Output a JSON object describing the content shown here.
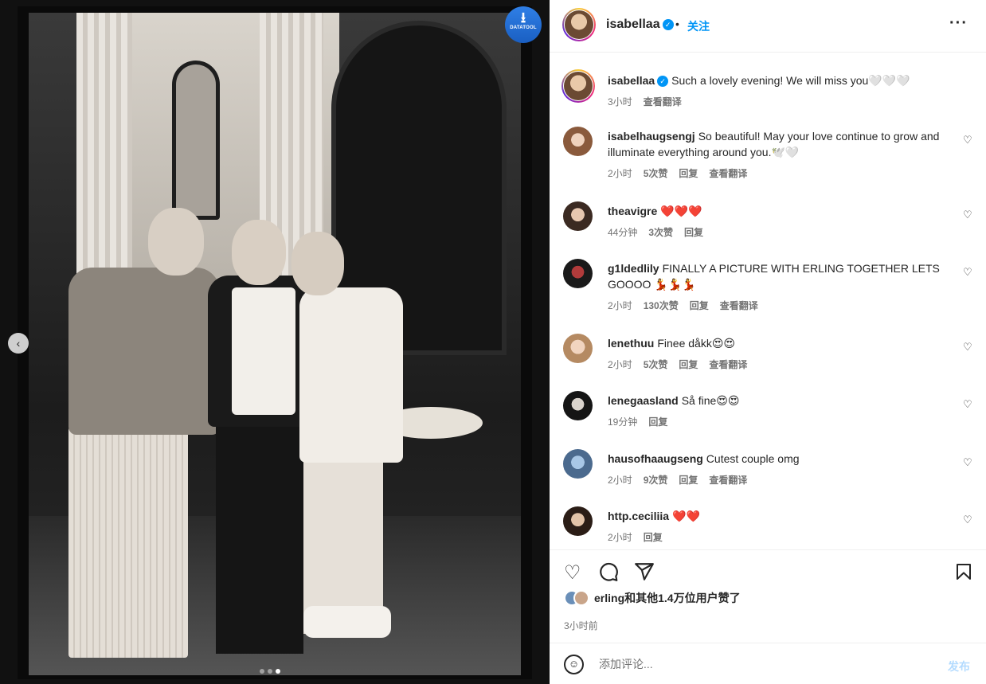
{
  "media": {
    "prev_glyph": "‹",
    "dots": 3,
    "active_dot": 2,
    "badge": {
      "label": "DATATOOL",
      "icon": "download-icon"
    }
  },
  "header": {
    "username": "isabellaa",
    "separator": "•",
    "follow_label": "关注",
    "more_icon": "more-horizontal-icon"
  },
  "comments": [
    {
      "username": "isabellaa",
      "verified": true,
      "text": "Such a lovely evening! We will miss you🤍🤍🤍",
      "time": "3小时",
      "likes": "",
      "reply": "",
      "translate": "查看翻译",
      "is_caption": true
    },
    {
      "username": "isabelhaugsengj",
      "text": "So beautiful! May your love continue to grow and illuminate everything around you.🕊️🤍",
      "time": "2小时",
      "likes": "5次赞",
      "reply": "回复",
      "translate": "查看翻译"
    },
    {
      "username": "theavigre",
      "text": "❤️❤️❤️",
      "time": "44分钟",
      "likes": "3次赞",
      "reply": "回复",
      "translate": ""
    },
    {
      "username": "g1ldedlily",
      "text": "FINALLY A PICTURE WITH ERLING TOGETHER LETS GOOOO 💃💃💃",
      "time": "2小时",
      "likes": "130次赞",
      "reply": "回复",
      "translate": "查看翻译"
    },
    {
      "username": "lenethuu",
      "text": "Finee dåkk😍😍",
      "time": "2小时",
      "likes": "5次赞",
      "reply": "回复",
      "translate": "查看翻译"
    },
    {
      "username": "lenegaasland",
      "text": "Så fine😍😍",
      "time": "19分钟",
      "likes": "",
      "reply": "回复",
      "translate": ""
    },
    {
      "username": "hausofhaaugseng",
      "text": "Cutest couple omg",
      "time": "2小时",
      "likes": "9次赞",
      "reply": "回复",
      "translate": "查看翻译"
    },
    {
      "username": "http.ceciliia",
      "text": "❤️❤️",
      "time": "2小时",
      "likes": "",
      "reply": "回复",
      "translate": ""
    }
  ],
  "actions": {
    "like_icon": "heart-icon",
    "comment_icon": "comment-icon",
    "share_icon": "send-icon",
    "save_icon": "bookmark-icon",
    "likes_text": "erling和其他1.4万位用户赞了",
    "posted_time": "3小时前"
  },
  "add_comment": {
    "placeholder": "添加评论...",
    "post_label": "发布",
    "emoji_icon": "smiley-icon"
  },
  "colors": {
    "accent": "#0095f6",
    "text": "#262626",
    "muted": "#737373",
    "post_disabled": "#b3dbff"
  }
}
